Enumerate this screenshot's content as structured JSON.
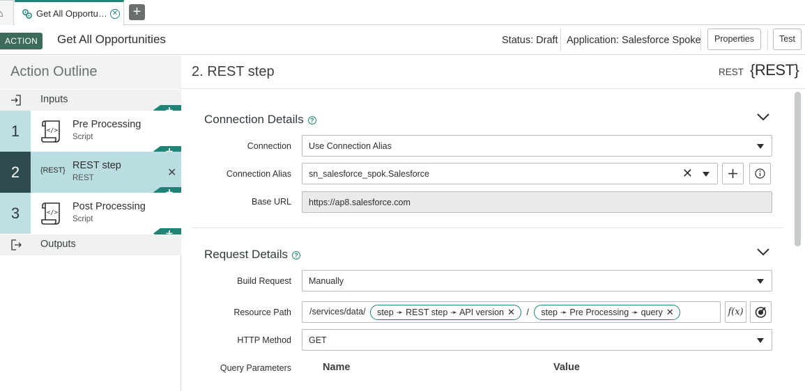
{
  "tabs": {
    "active_title": "Get All Opportu…",
    "add_label": "+"
  },
  "header": {
    "badge": "ACTION",
    "title": "Get All Opportunities",
    "status": "Status: Draft",
    "application": "Application: Salesforce Spoke",
    "properties_label": "Properties",
    "test_label": "Test"
  },
  "outline": {
    "title": "Action Outline",
    "inputs_label": "Inputs",
    "outputs_label": "Outputs",
    "steps": [
      {
        "number": "1",
        "name": "Pre Processing",
        "type": "Script",
        "icon": "script-icon"
      },
      {
        "number": "2",
        "name": "REST step",
        "type": "REST",
        "icon": "rest-icon",
        "icon_text": "{REST}",
        "selected": true
      },
      {
        "number": "3",
        "name": "Post Processing",
        "type": "Script",
        "icon": "script-icon"
      }
    ]
  },
  "step": {
    "title": "2.  REST step",
    "type_label": "REST",
    "logo": "{REST}"
  },
  "connection": {
    "title": "Connection Details",
    "connection_label": "Connection",
    "connection_value": "Use Connection Alias",
    "alias_label": "Connection Alias",
    "alias_value": "sn_salesforce_spok.Salesforce",
    "base_url_label": "Base URL",
    "base_url_value": "https://ap8.salesforce.com"
  },
  "request": {
    "title": "Request Details",
    "build_label": "Build Request",
    "build_value": "Manually",
    "resource_label": "Resource Path",
    "resource_prefix": "/services/data/",
    "resource_pill_1": "step ➛ REST step ➛ API version",
    "resource_sep": "/",
    "resource_pill_2": "step ➛ Pre Processing ➛ query",
    "method_label": "HTTP Method",
    "method_value": "GET",
    "query_label": "Query Parameters",
    "col_name": "Name",
    "col_value": "Value"
  },
  "colors": {
    "accent": "#1f8476",
    "badge": "#3c6b5d",
    "selected_step": "#b9dde1",
    "step_number_bg": "#bfe0e3"
  }
}
